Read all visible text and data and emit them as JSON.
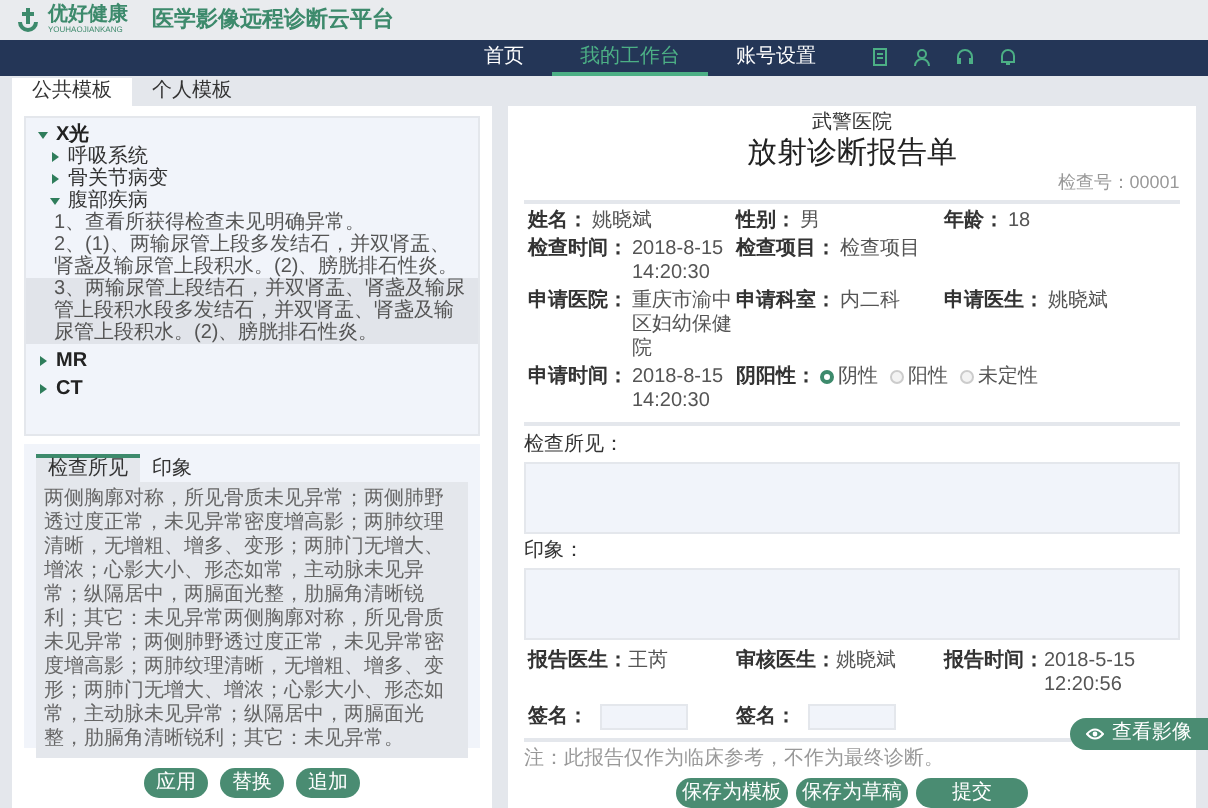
{
  "logo": {
    "name": "优好健康",
    "subtitle": "YOUHAOJIANKANG"
  },
  "app_title": "医学影像远程诊断云平台",
  "nav": [
    {
      "label": "首页",
      "selected": false
    },
    {
      "label": "我的工作台",
      "selected": true
    },
    {
      "label": "账号设置",
      "selected": false
    }
  ],
  "template_tabs": [
    {
      "label": "公共模板",
      "selected": true
    },
    {
      "label": "个人模板",
      "selected": false
    }
  ],
  "tree": [
    {
      "label": "X光",
      "expanded": true,
      "children": [
        {
          "label": "呼吸系统",
          "expanded": false
        },
        {
          "label": "骨关节病变",
          "expanded": false
        },
        {
          "label": "腹部疾病",
          "expanded": true,
          "children": [
            {
              "label": "1、查看所获得检查未见明确异常。",
              "selected": false
            },
            {
              "label": "2、(1)、两输尿管上段多发结石，并双肾盂、肾盏及输尿管上段积水。(2)、膀胱排石性炎。",
              "selected": false
            },
            {
              "label": "3、两输尿管上段结石，并双肾盂、肾盏及输尿管上段积水段多发结石，并双肾盂、肾盏及输尿管上段积水。(2)、膀胱排石性炎。",
              "selected": true
            }
          ]
        }
      ]
    },
    {
      "label": "MR",
      "expanded": false
    },
    {
      "label": "CT",
      "expanded": false
    }
  ],
  "preview": {
    "tabs": [
      {
        "label": "检查所见",
        "selected": true
      },
      {
        "label": "印象",
        "selected": false
      }
    ],
    "text": "两侧胸廓对称，所见骨质未见异常；两侧肺野透过度正常，未见异常密度增高影；两肺纹理清晰，无增粗、增多、变形；两肺门无增大、增浓；心影大小、形态如常，主动脉未见异常；纵隔居中，两膈面光整，肋膈角清晰锐利；其它：未见异常两侧胸廓对称，所见骨质未见异常；两侧肺野透过度正常，未见异常密度增高影；两肺纹理清晰，无增粗、增多、变形；两肺门无增大、增浓；心影大小、形态如常，主动脉未见异常；纵隔居中，两膈面光整，肋膈角清晰锐利；其它：未见异常。"
  },
  "template_buttons": [
    "应用",
    "替换",
    "追加"
  ],
  "report": {
    "hospital": "武警医院",
    "title": "放射诊断报告单",
    "exam_no": "检查号：00001",
    "rows": [
      [
        {
          "label": "姓名：",
          "value": "姚晓斌"
        },
        {
          "label": "性别：",
          "value": "男"
        },
        {
          "label": "年龄：",
          "value": "18"
        }
      ],
      [
        {
          "label": "检查时间：",
          "value": "2018-8-15 14:20:30"
        },
        {
          "label": "检查项目：",
          "value": "检查项目"
        }
      ],
      [
        {
          "label": "申请医院：",
          "value": "重庆市渝中区妇幼保健院"
        },
        {
          "label": "申请科室：",
          "value": "内二科"
        },
        {
          "label": "申请医生：",
          "value": "姚晓斌"
        }
      ],
      [
        {
          "label": "申请时间：",
          "value": "2018-8-15 14:20:30"
        },
        {
          "label": "阴阳性：",
          "kind": "radio",
          "options": [
            {
              "label": "阴性",
              "selected": true
            },
            {
              "label": "阳性",
              "selected": false
            },
            {
              "label": "未定性",
              "selected": false
            }
          ]
        }
      ]
    ],
    "findings_label": "检查所见：",
    "impression_label": "印象：",
    "staff": [
      {
        "label": "报告医生：",
        "value": "王芮"
      },
      {
        "label": "审核医生：",
        "value": "姚晓斌"
      },
      {
        "label": "报告时间：",
        "value": "2018-5-15 12:20:56"
      }
    ],
    "signatures": [
      "签名：",
      "签名："
    ],
    "note": "注：此报告仅作为临床参考，不作为最终诊断。",
    "buttons": [
      "保存为模板",
      "保存为草稿",
      "提交"
    ]
  },
  "float_button": "查看影像"
}
